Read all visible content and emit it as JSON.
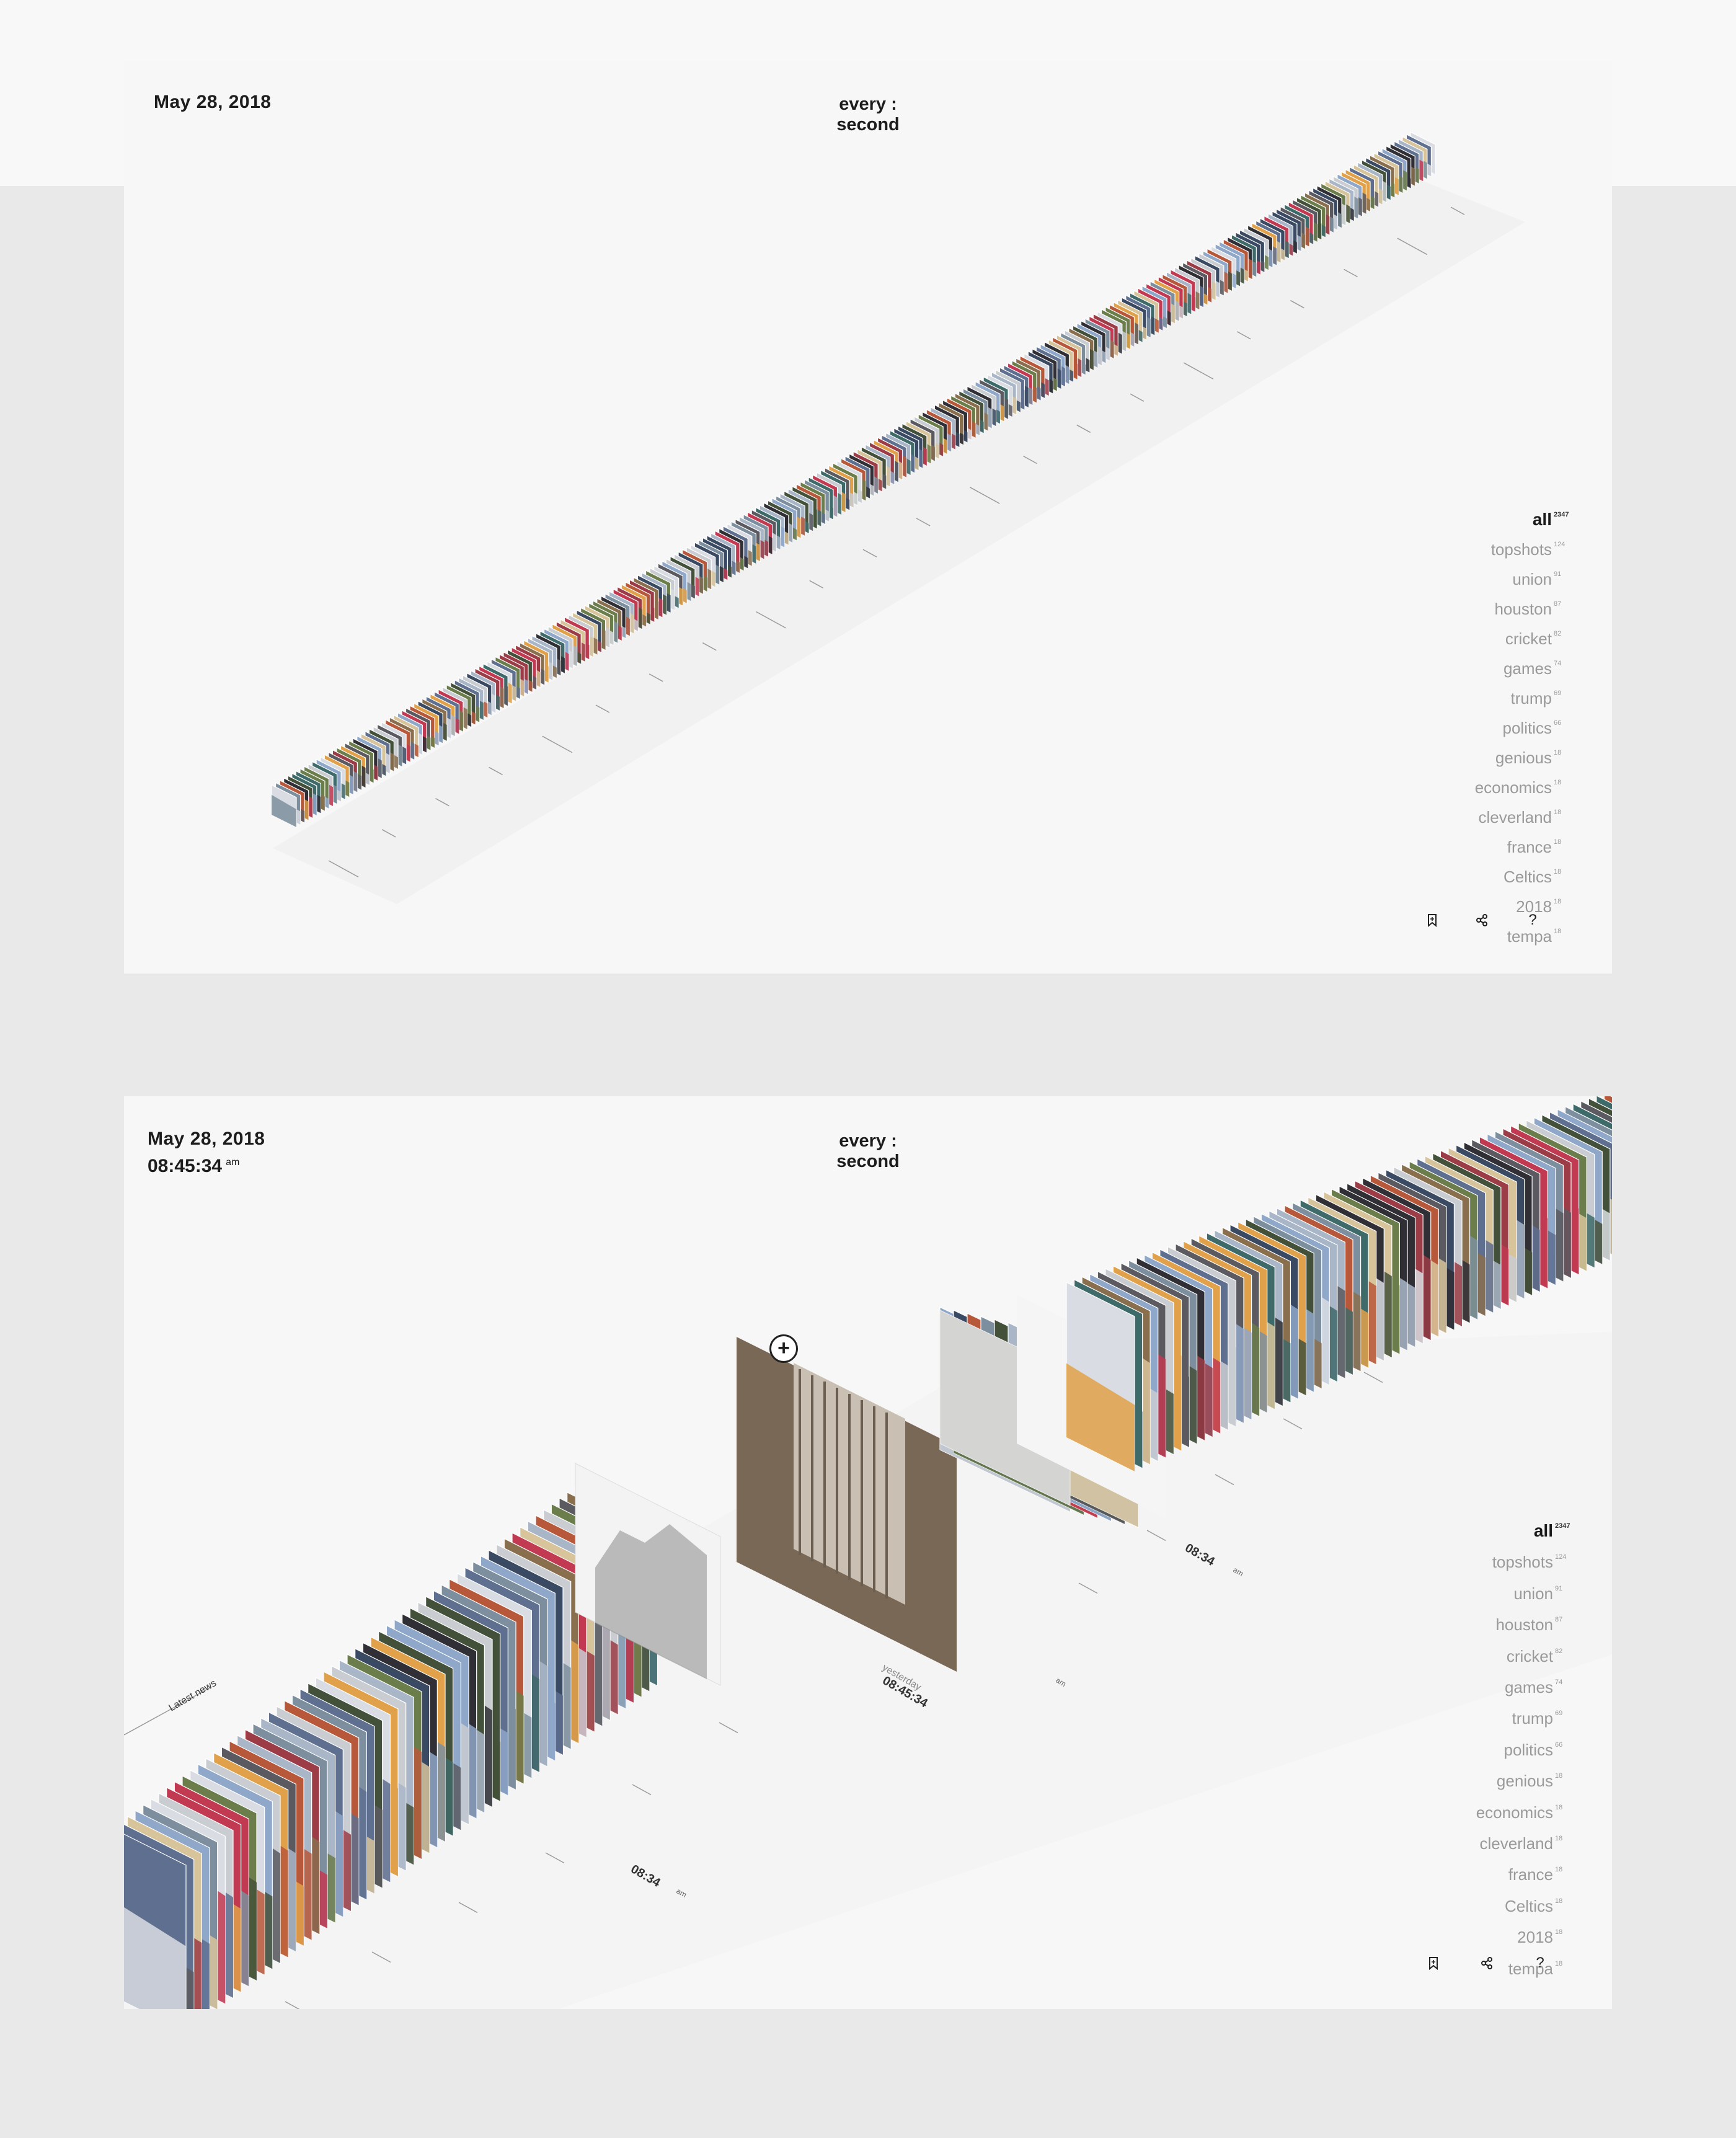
{
  "top": {
    "date": "May 28, 2018",
    "mode": "every : second"
  },
  "bottom": {
    "date": "May 28, 2018",
    "time": "08:45:34",
    "ampm": "am",
    "mode": "every : second",
    "latest_label": "Latest news",
    "marker_time_short": "08:34",
    "marker_time_long": "08:45:34",
    "marker_day": "yesterday",
    "marker_ampm": "am",
    "zoom_in_glyph": "+"
  },
  "tags": [
    {
      "label": "all",
      "count": "2347",
      "active": true
    },
    {
      "label": "topshots",
      "count": "124"
    },
    {
      "label": "union",
      "count": "91"
    },
    {
      "label": "houston",
      "count": "87"
    },
    {
      "label": "cricket",
      "count": "82"
    },
    {
      "label": "games",
      "count": "74"
    },
    {
      "label": "trump",
      "count": "69"
    },
    {
      "label": "politics",
      "count": "66"
    },
    {
      "label": "genious",
      "count": "18"
    },
    {
      "label": "economics",
      "count": "18"
    },
    {
      "label": "cleverland",
      "count": "18"
    },
    {
      "label": "france",
      "count": "18"
    },
    {
      "label": "Celtics",
      "count": "18"
    },
    {
      "label": "2018",
      "count": "18"
    },
    {
      "label": "tempa",
      "count": "18"
    }
  ],
  "tools": {
    "bookmark_icon": "bookmark-icon",
    "share_icon": "share-icon",
    "help_label": "?"
  },
  "colors": {
    "panel_bg": "#f7f7f7",
    "page_bg": "#e9e9e9",
    "text_dark": "#1d1d1d",
    "text_muted": "#9a9a9a"
  }
}
